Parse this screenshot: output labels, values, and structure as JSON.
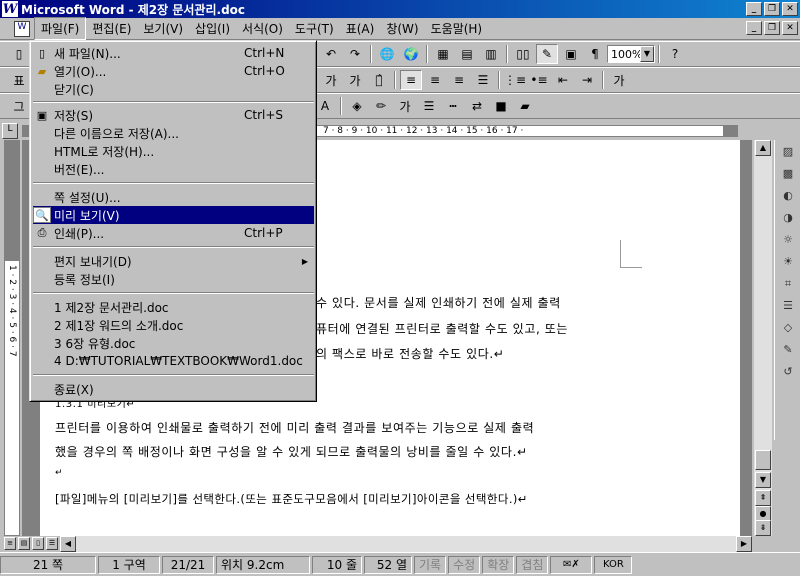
{
  "titlebar": {
    "logo": "W",
    "title": "Microsoft Word - 제2장 문서관리.doc",
    "buttons": [
      "_",
      "❐",
      "✕"
    ]
  },
  "menubar": {
    "items": [
      {
        "label": "파일(F)"
      },
      {
        "label": "편집(E)"
      },
      {
        "label": "보기(V)"
      },
      {
        "label": "삽입(I)"
      },
      {
        "label": "서식(O)"
      },
      {
        "label": "도구(T)"
      },
      {
        "label": "표(A)"
      },
      {
        "label": "창(W)"
      },
      {
        "label": "도움말(H)"
      }
    ],
    "doc_buttons": [
      "_",
      "❐",
      "✕"
    ]
  },
  "toolbar": {
    "zoom": "100%",
    "style_prefix": "표",
    "style_prefix2": "그",
    "font_color_label": "가"
  },
  "file_menu": {
    "items": [
      {
        "label": "새 파일(N)...",
        "shortcut": "Ctrl+N",
        "icon": "new-file-icon"
      },
      {
        "label": "열기(O)...",
        "shortcut": "Ctrl+O",
        "icon": "open-folder-icon"
      },
      {
        "label": "닫기(C)",
        "shortcut": ""
      },
      {
        "label": "저장(S)",
        "shortcut": "Ctrl+S",
        "icon": "save-disk-icon"
      },
      {
        "label": "다른 이름으로 저장(A)...",
        "shortcut": ""
      },
      {
        "label": "HTML로 저장(H)...",
        "shortcut": ""
      },
      {
        "label": "버전(E)...",
        "shortcut": ""
      },
      {
        "label": "쪽 설정(U)...",
        "shortcut": ""
      },
      {
        "label": "미리 보기(V)",
        "shortcut": "",
        "icon": "print-preview-icon",
        "highlighted": true
      },
      {
        "label": "인쇄(P)...",
        "shortcut": "Ctrl+P",
        "icon": "printer-icon"
      },
      {
        "label": "편지 보내기(D)",
        "shortcut": "",
        "submenu": true
      },
      {
        "label": "등록 정보(I)",
        "shortcut": ""
      },
      {
        "label": "1 제2장 문서관리.doc",
        "shortcut": ""
      },
      {
        "label": "2 제1장 워드의 소개.doc",
        "shortcut": ""
      },
      {
        "label": "3 6장 유형.doc",
        "shortcut": ""
      },
      {
        "label": "4 D:₩TUTORIAL₩TEXTBOOK₩Word1.doc",
        "shortcut": ""
      },
      {
        "label": "종료(X)",
        "shortcut": ""
      }
    ]
  },
  "ruler": {
    "ticks": "7 · 8 · 9 · 10 · 11 · 12 · 13 · 14 · 15 · 16 · 17 ·",
    "vertical": "1 · 2 · 3 · 4 · 5 · 6 · 7"
  },
  "document": {
    "lines": [
      "수 있다. 문서를 실제 인쇄하기 전에 실제 출력",
      "퓨터에 연결된 프린터로 출력할 수도 있고,  또는",
      "의 팩스로 바로 전송할 수도 있다.↵",
      "1.3.1       미리보기↵",
      "프린터를 이용하여 인쇄물로 출력하기 전에 미리 출력 결과를 보여주는 기능으로 실제 출력",
      "했을 경우의 쪽 배정이나 화면 구성을 알 수 있게 되므로 출력물의 낭비를 줄일 수 있다.↵",
      "↵",
      "[파일]메뉴의 [미리보기]를 선택한다.(또는 표준도구모음에서 [미리보기]아이콘을 선택한다.)↵"
    ]
  },
  "statusbar": {
    "page": "21 쪽",
    "section": "1 구역",
    "pages": "21/21",
    "position": "위치 9.2cm",
    "line": "10 줄",
    "column": "52 열",
    "rec": "기록",
    "trk": "수정",
    "ext": "확장",
    "ovr": "겹침",
    "lang": "KOR"
  }
}
